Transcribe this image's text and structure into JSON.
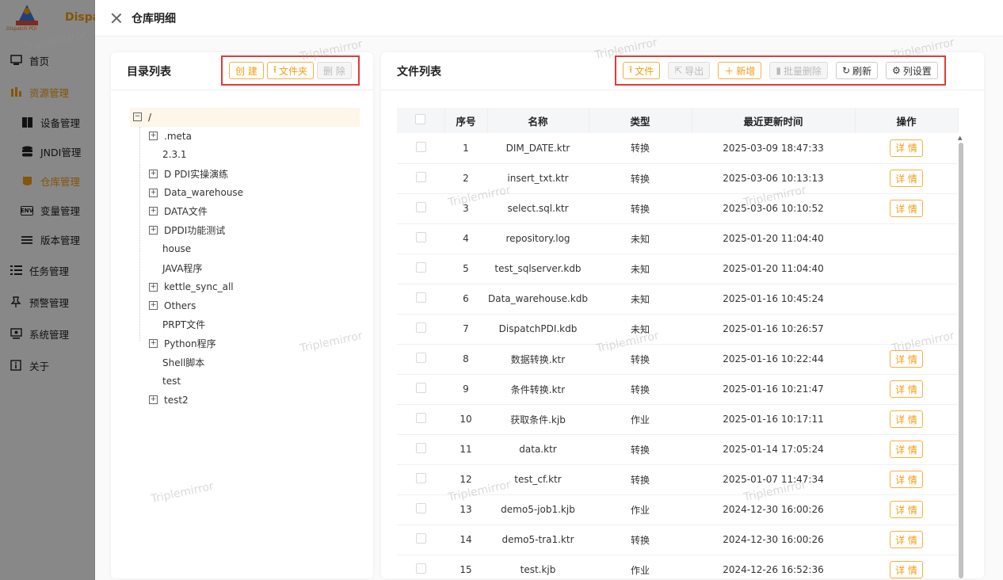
{
  "app": {
    "logo_text": "Dispa",
    "logo_sub": "Dispatch PDI",
    "colors": {
      "accent": "#f39c12",
      "highlight_border": "#e53935"
    }
  },
  "sidebar": {
    "items": [
      {
        "label": "首页",
        "icon": "monitor-icon"
      },
      {
        "label": "资源管理",
        "icon": "chart-icon"
      },
      {
        "label": "设备管理",
        "icon": "server-icon"
      },
      {
        "label": "JNDI管理",
        "icon": "database-icon"
      },
      {
        "label": "仓库管理",
        "icon": "repository-icon"
      },
      {
        "label": "变量管理",
        "icon": "env-icon"
      },
      {
        "label": "版本管理",
        "icon": "menu-icon"
      },
      {
        "label": "任务管理",
        "icon": "list-icon"
      },
      {
        "label": "预警管理",
        "icon": "pin-icon"
      },
      {
        "label": "系统管理",
        "icon": "settings-monitor-icon"
      },
      {
        "label": "关于",
        "icon": "info-icon"
      }
    ]
  },
  "drawer": {
    "title": "仓库明细"
  },
  "left_panel": {
    "title": "目录列表",
    "buttons": {
      "create": "创 建",
      "folder": "文件夹",
      "delete": "删 除"
    },
    "tree": {
      "root": "/",
      "children": [
        {
          "label": ".meta",
          "expandable": true
        },
        {
          "label": "2.3.1",
          "expandable": false
        },
        {
          "label": "D PDI实操演练",
          "expandable": true
        },
        {
          "label": "Data_warehouse",
          "expandable": true
        },
        {
          "label": "DATA文件",
          "expandable": true
        },
        {
          "label": "DPDI功能测试",
          "expandable": true
        },
        {
          "label": "house",
          "expandable": false
        },
        {
          "label": "JAVA程序",
          "expandable": false
        },
        {
          "label": "kettle_sync_all",
          "expandable": true
        },
        {
          "label": "Others",
          "expandable": true
        },
        {
          "label": "PRPT文件",
          "expandable": false
        },
        {
          "label": "Python程序",
          "expandable": true
        },
        {
          "label": "Shell脚本",
          "expandable": false
        },
        {
          "label": "test",
          "expandable": false
        },
        {
          "label": "test2",
          "expandable": true
        }
      ]
    }
  },
  "right_panel": {
    "title": "文件列表",
    "buttons": {
      "file": "文件",
      "export": "导出",
      "add": "新增",
      "batch_delete": "批量删除",
      "refresh": "刷新",
      "columns": "列设置"
    },
    "table": {
      "headers": [
        "序号",
        "名称",
        "类型",
        "最近更新时间",
        "操作"
      ],
      "detail_label": "详 情",
      "rows": [
        {
          "no": "1",
          "name": "DIM_DATE.ktr",
          "type": "转换",
          "time": "2025-03-09 18:47:33",
          "detail": true
        },
        {
          "no": "2",
          "name": "insert_txt.ktr",
          "type": "转换",
          "time": "2025-03-06 10:13:13",
          "detail": true
        },
        {
          "no": "3",
          "name": "select.sql.ktr",
          "type": "转换",
          "time": "2025-03-06 10:10:52",
          "detail": true
        },
        {
          "no": "4",
          "name": "repository.log",
          "type": "未知",
          "time": "2025-01-20 11:04:40",
          "detail": false
        },
        {
          "no": "5",
          "name": "test_sqlserver.kdb",
          "type": "未知",
          "time": "2025-01-20 11:04:40",
          "detail": false
        },
        {
          "no": "6",
          "name": "Data_warehouse.kdb",
          "type": "未知",
          "time": "2025-01-16 10:45:24",
          "detail": false
        },
        {
          "no": "7",
          "name": "DispatchPDI.kdb",
          "type": "未知",
          "time": "2025-01-16 10:26:57",
          "detail": false
        },
        {
          "no": "8",
          "name": "数据转换.ktr",
          "type": "转换",
          "time": "2025-01-16 10:22:44",
          "detail": true
        },
        {
          "no": "9",
          "name": "条件转换.ktr",
          "type": "转换",
          "time": "2025-01-16 10:21:47",
          "detail": true
        },
        {
          "no": "10",
          "name": "获取条件.kjb",
          "type": "作业",
          "time": "2025-01-16 10:17:11",
          "detail": true
        },
        {
          "no": "11",
          "name": "data.ktr",
          "type": "转换",
          "time": "2025-01-14 17:05:24",
          "detail": true
        },
        {
          "no": "12",
          "name": "test_cf.ktr",
          "type": "转换",
          "time": "2025-01-07 11:47:34",
          "detail": true
        },
        {
          "no": "13",
          "name": "demo5-job1.kjb",
          "type": "作业",
          "time": "2024-12-30 16:00:26",
          "detail": true
        },
        {
          "no": "14",
          "name": "demo5-tra1.ktr",
          "type": "转换",
          "time": "2024-12-30 16:00:26",
          "detail": true
        },
        {
          "no": "15",
          "name": "test.kjb",
          "type": "作业",
          "time": "2024-12-26 16:52:36",
          "detail": true
        }
      ]
    }
  },
  "watermark": "Triplemirror"
}
